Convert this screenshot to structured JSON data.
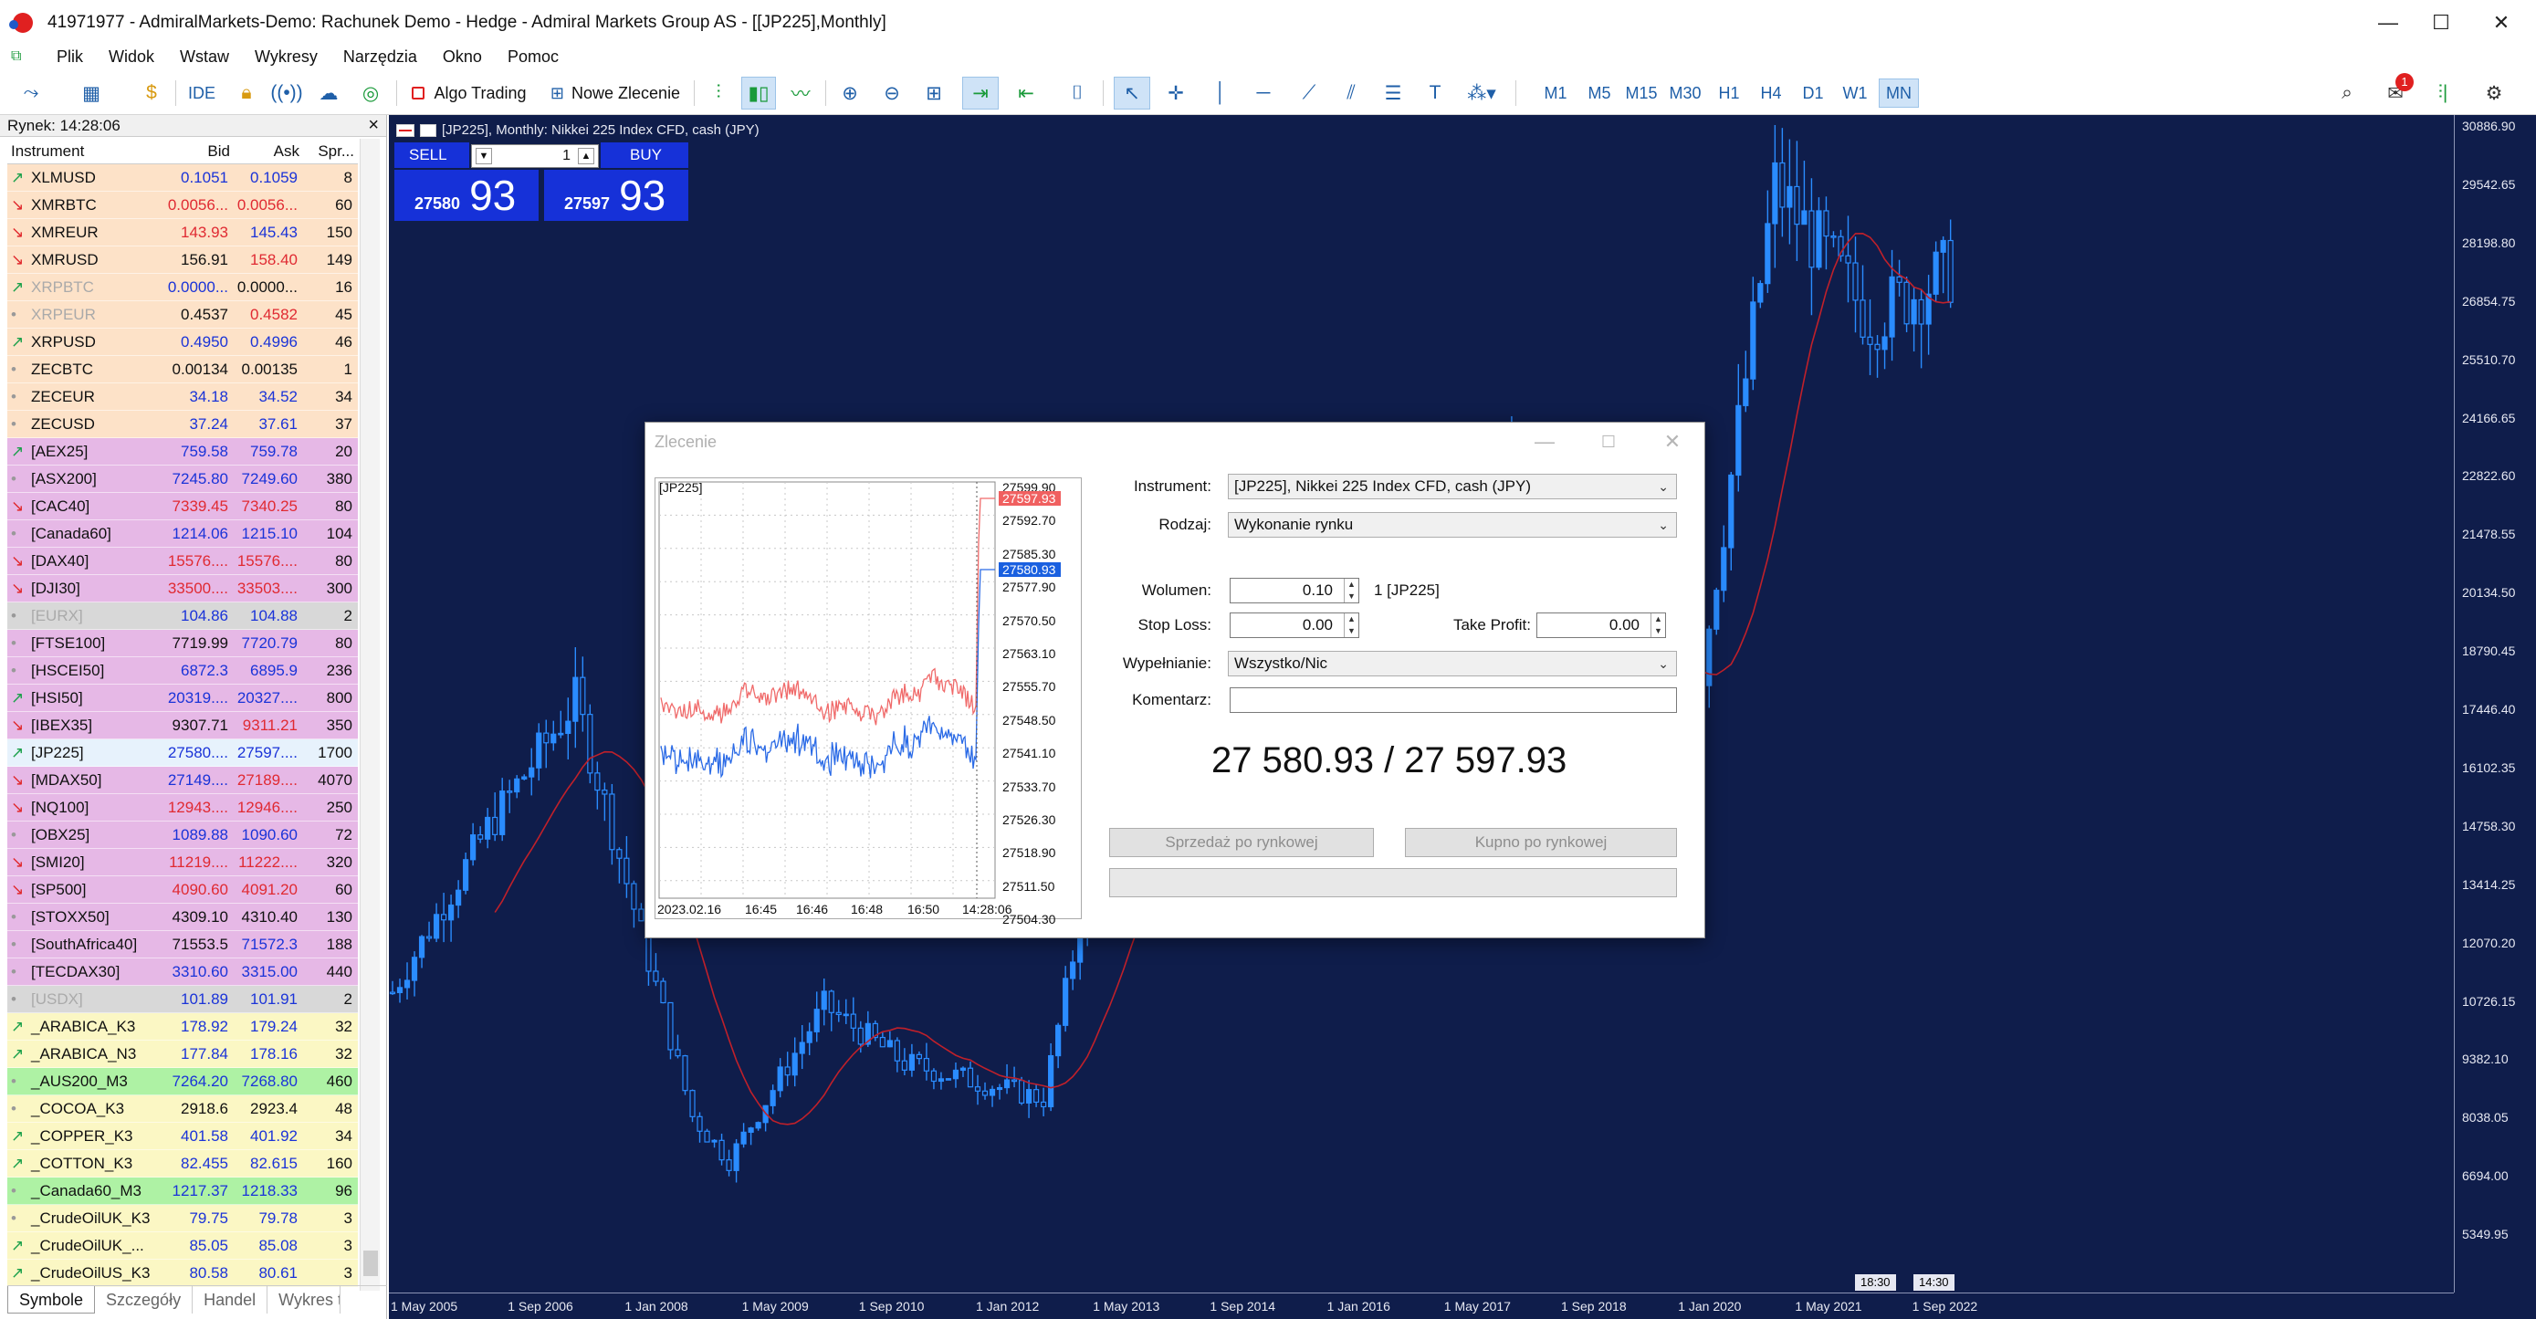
{
  "window": {
    "title": "41971977 - AdmiralMarkets-Demo: Rachunek Demo - Hedge - Admiral Markets Group AS - [[JP225],Monthly]",
    "controls": {
      "minimize": "—",
      "maximize": "☐",
      "close": "✕"
    }
  },
  "menu": [
    "Plik",
    "Widok",
    "Wstaw",
    "Wykresy",
    "Narzędzia",
    "Okno",
    "Pomoc"
  ],
  "toolbar": {
    "ide_label": "IDE",
    "algo_label": "Algo Trading",
    "neworder_label": "Nowe Zlecenie",
    "timeframes": [
      "M1",
      "M5",
      "M15",
      "M30",
      "H1",
      "H4",
      "D1",
      "W1",
      "MN"
    ],
    "active_timeframe": "MN",
    "notification_count": "1"
  },
  "market_watch": {
    "title": "Rynek: 14:28:06",
    "close_label": "×",
    "columns": {
      "instrument": "Instrument",
      "bid": "Bid",
      "ask": "Ask",
      "spread": "Spr..."
    },
    "rows": [
      {
        "arrow": "↗",
        "dir": "up",
        "name": "XLMUSD",
        "bid": "0.1051",
        "ask": "0.1059",
        "spread": "8",
        "group": "g-or",
        "bidc": "blue",
        "askc": "blue"
      },
      {
        "arrow": "↘",
        "dir": "dn",
        "name": "XMRBTC",
        "bid": "0.0056...",
        "ask": "0.0056...",
        "spread": "60",
        "group": "g-or",
        "bidc": "red",
        "askc": "red"
      },
      {
        "arrow": "↘",
        "dir": "dn",
        "name": "XMREUR",
        "bid": "143.93",
        "ask": "145.43",
        "spread": "150",
        "group": "g-or",
        "bidc": "red",
        "askc": "blue"
      },
      {
        "arrow": "↘",
        "dir": "dn",
        "name": "XMRUSD",
        "bid": "156.91",
        "ask": "158.40",
        "spread": "149",
        "group": "g-or",
        "bidc": "",
        "askc": "red"
      },
      {
        "arrow": "↗",
        "dir": "up",
        "name": "XRPBTC",
        "bid": "0.0000...",
        "ask": "0.0000...",
        "spread": "16",
        "group": "g-or",
        "bidc": "blue",
        "askc": "",
        "namec": "gray"
      },
      {
        "arrow": "•",
        "dir": "dot",
        "name": "XRPEUR",
        "bid": "0.4537",
        "ask": "0.4582",
        "spread": "45",
        "group": "g-or",
        "bidc": "",
        "askc": "red",
        "namec": "gray"
      },
      {
        "arrow": "↗",
        "dir": "up",
        "name": "XRPUSD",
        "bid": "0.4950",
        "ask": "0.4996",
        "spread": "46",
        "group": "g-or",
        "bidc": "blue",
        "askc": "blue"
      },
      {
        "arrow": "•",
        "dir": "dot",
        "name": "ZECBTC",
        "bid": "0.00134",
        "ask": "0.00135",
        "spread": "1",
        "group": "g-or",
        "bidc": "",
        "askc": ""
      },
      {
        "arrow": "•",
        "dir": "dot",
        "name": "ZECEUR",
        "bid": "34.18",
        "ask": "34.52",
        "spread": "34",
        "group": "g-or",
        "bidc": "blue",
        "askc": "blue"
      },
      {
        "arrow": "•",
        "dir": "dot",
        "name": "ZECUSD",
        "bid": "37.24",
        "ask": "37.61",
        "spread": "37",
        "group": "g-or",
        "bidc": "blue",
        "askc": "blue"
      },
      {
        "arrow": "↗",
        "dir": "up",
        "name": "[AEX25]",
        "bid": "759.58",
        "ask": "759.78",
        "spread": "20",
        "group": "g-pu",
        "bidc": "blue",
        "askc": "blue"
      },
      {
        "arrow": "•",
        "dir": "dot",
        "name": "[ASX200]",
        "bid": "7245.80",
        "ask": "7249.60",
        "spread": "380",
        "group": "g-pu",
        "bidc": "blue",
        "askc": "blue"
      },
      {
        "arrow": "↘",
        "dir": "dn",
        "name": "[CAC40]",
        "bid": "7339.45",
        "ask": "7340.25",
        "spread": "80",
        "group": "g-pu",
        "bidc": "red",
        "askc": "red"
      },
      {
        "arrow": "•",
        "dir": "dot",
        "name": "[Canada60]",
        "bid": "1214.06",
        "ask": "1215.10",
        "spread": "104",
        "group": "g-pu",
        "bidc": "blue",
        "askc": "blue"
      },
      {
        "arrow": "↘",
        "dir": "dn",
        "name": "[DAX40]",
        "bid": "15576....",
        "ask": "15576....",
        "spread": "80",
        "group": "g-pu",
        "bidc": "red",
        "askc": "red"
      },
      {
        "arrow": "↘",
        "dir": "dn",
        "name": "[DJI30]",
        "bid": "33500....",
        "ask": "33503....",
        "spread": "300",
        "group": "g-pu",
        "bidc": "red",
        "askc": "red"
      },
      {
        "arrow": "•",
        "dir": "dot",
        "name": "[EURX]",
        "bid": "104.86",
        "ask": "104.88",
        "spread": "2",
        "group": "g-gr",
        "bidc": "blue",
        "askc": "blue",
        "namec": "gray"
      },
      {
        "arrow": "•",
        "dir": "dot",
        "name": "[FTSE100]",
        "bid": "7719.99",
        "ask": "7720.79",
        "spread": "80",
        "group": "g-pu",
        "bidc": "",
        "askc": "blue"
      },
      {
        "arrow": "•",
        "dir": "dot",
        "name": "[HSCEI50]",
        "bid": "6872.3",
        "ask": "6895.9",
        "spread": "236",
        "group": "g-pu",
        "bidc": "blue",
        "askc": "blue"
      },
      {
        "arrow": "↗",
        "dir": "up",
        "name": "[HSI50]",
        "bid": "20319....",
        "ask": "20327....",
        "spread": "800",
        "group": "g-pu",
        "bidc": "blue",
        "askc": "blue"
      },
      {
        "arrow": "↘",
        "dir": "dn",
        "name": "[IBEX35]",
        "bid": "9307.71",
        "ask": "9311.21",
        "spread": "350",
        "group": "g-pu",
        "bidc": "",
        "askc": "red"
      },
      {
        "arrow": "↗",
        "dir": "up",
        "name": "[JP225]",
        "bid": "27580....",
        "ask": "27597....",
        "spread": "1700",
        "group": "g-sel",
        "bidc": "blue",
        "askc": "blue"
      },
      {
        "arrow": "↘",
        "dir": "dn",
        "name": "[MDAX50]",
        "bid": "27149....",
        "ask": "27189....",
        "spread": "4070",
        "group": "g-pu",
        "bidc": "blue",
        "askc": "red"
      },
      {
        "arrow": "↘",
        "dir": "dn",
        "name": "[NQ100]",
        "bid": "12943....",
        "ask": "12946....",
        "spread": "250",
        "group": "g-pu",
        "bidc": "red",
        "askc": "red"
      },
      {
        "arrow": "•",
        "dir": "dot",
        "name": "[OBX25]",
        "bid": "1089.88",
        "ask": "1090.60",
        "spread": "72",
        "group": "g-pu",
        "bidc": "blue",
        "askc": "blue"
      },
      {
        "arrow": "↘",
        "dir": "dn",
        "name": "[SMI20]",
        "bid": "11219....",
        "ask": "11222....",
        "spread": "320",
        "group": "g-pu",
        "bidc": "red",
        "askc": "red"
      },
      {
        "arrow": "↘",
        "dir": "dn",
        "name": "[SP500]",
        "bid": "4090.60",
        "ask": "4091.20",
        "spread": "60",
        "group": "g-pu",
        "bidc": "red",
        "askc": "red"
      },
      {
        "arrow": "•",
        "dir": "dot",
        "name": "[STOXX50]",
        "bid": "4309.10",
        "ask": "4310.40",
        "spread": "130",
        "group": "g-pu",
        "bidc": "",
        "askc": ""
      },
      {
        "arrow": "•",
        "dir": "dot",
        "name": "[SouthAfrica40]",
        "bid": "71553.5",
        "ask": "71572.3",
        "spread": "188",
        "group": "g-pu",
        "bidc": "",
        "askc": "blue"
      },
      {
        "arrow": "•",
        "dir": "dot",
        "name": "[TECDAX30]",
        "bid": "3310.60",
        "ask": "3315.00",
        "spread": "440",
        "group": "g-pu",
        "bidc": "blue",
        "askc": "blue"
      },
      {
        "arrow": "•",
        "dir": "dot",
        "name": "[USDX]",
        "bid": "101.89",
        "ask": "101.91",
        "spread": "2",
        "group": "g-gr",
        "bidc": "blue",
        "askc": "blue",
        "namec": "gray"
      },
      {
        "arrow": "↗",
        "dir": "up",
        "name": "_ARABICA_K3",
        "bid": "178.92",
        "ask": "179.24",
        "spread": "32",
        "group": "g-ye",
        "bidc": "blue",
        "askc": "blue"
      },
      {
        "arrow": "↗",
        "dir": "up",
        "name": "_ARABICA_N3",
        "bid": "177.84",
        "ask": "178.16",
        "spread": "32",
        "group": "g-ye",
        "bidc": "blue",
        "askc": "blue"
      },
      {
        "arrow": "•",
        "dir": "dot",
        "name": "_AUS200_M3",
        "bid": "7264.20",
        "ask": "7268.80",
        "spread": "460",
        "group": "g-ge",
        "bidc": "blue",
        "askc": "blue"
      },
      {
        "arrow": "•",
        "dir": "dot",
        "name": "_COCOA_K3",
        "bid": "2918.6",
        "ask": "2923.4",
        "spread": "48",
        "group": "g-ye",
        "bidc": "",
        "askc": ""
      },
      {
        "arrow": "↗",
        "dir": "up",
        "name": "_COPPER_K3",
        "bid": "401.58",
        "ask": "401.92",
        "spread": "34",
        "group": "g-ye",
        "bidc": "blue",
        "askc": "blue"
      },
      {
        "arrow": "↗",
        "dir": "up",
        "name": "_COTTON_K3",
        "bid": "82.455",
        "ask": "82.615",
        "spread": "160",
        "group": "g-ye",
        "bidc": "blue",
        "askc": "blue"
      },
      {
        "arrow": "•",
        "dir": "dot",
        "name": "_Canada60_M3",
        "bid": "1217.37",
        "ask": "1218.33",
        "spread": "96",
        "group": "g-ge",
        "bidc": "blue",
        "askc": "blue"
      },
      {
        "arrow": "•",
        "dir": "dot",
        "name": "_CrudeOilUK_K3",
        "bid": "79.75",
        "ask": "79.78",
        "spread": "3",
        "group": "g-ye",
        "bidc": "blue",
        "askc": "blue"
      },
      {
        "arrow": "↗",
        "dir": "up",
        "name": "_CrudeOilUK_...",
        "bid": "85.05",
        "ask": "85.08",
        "spread": "3",
        "group": "g-ye",
        "bidc": "blue",
        "askc": "blue"
      },
      {
        "arrow": "↗",
        "dir": "up",
        "name": "_CrudeOilUS_K3",
        "bid": "80.58",
        "ask": "80.61",
        "spread": "3",
        "group": "g-ye",
        "bidc": "blue",
        "askc": "blue"
      }
    ],
    "tabs": [
      "Symbole",
      "Szczegóły",
      "Handel",
      "Wykres ticków"
    ],
    "active_tab": "Symbole"
  },
  "chart": {
    "header": "[JP225], Monthly:  Nikkei 225 Index CFD, cash (JPY)",
    "one_click": {
      "sell_label": "SELL",
      "buy_label": "BUY",
      "volume": "1",
      "sell_small": "27580",
      "sell_big": "93",
      "buy_small": "27597",
      "buy_big": "93"
    },
    "colors": {
      "background": "#0f1d4b",
      "bull": "#2a8cff",
      "ma": "#c0202a"
    },
    "y_ticks": [
      "30886.90",
      "29542.65",
      "28198.80",
      "26854.75",
      "25510.70",
      "24166.65",
      "22822.60",
      "21478.55",
      "20134.50",
      "18790.45",
      "17446.40",
      "16102.35",
      "14758.30",
      "13414.25",
      "12070.20",
      "10726.15",
      "9382.10",
      "8038.05",
      "6694.00",
      "5349.95"
    ],
    "x_ticks": [
      "1 May 2005",
      "1 Sep 2006",
      "1 Jan 2008",
      "1 May 2009",
      "1 Sep 2010",
      "1 Jan 2012",
      "1 May 2013",
      "1 Sep 2014",
      "1 Jan 2016",
      "1 May 2017",
      "1 Sep 2018",
      "1 Jan 2020",
      "1 May 2021",
      "1 Sep 2022"
    ],
    "time_boxes": [
      "18:30",
      "14:30"
    ]
  },
  "chart_data": {
    "type": "candlestick",
    "series": [
      {
        "name": "[JP225]",
        "timeframe": "Monthly"
      }
    ],
    "ylim": [
      5349.95,
      30886.9
    ],
    "x_range": [
      "2005-04",
      "2023-02"
    ],
    "close_approx": [
      {
        "x": "2005-05",
        "y": 11300
      },
      {
        "x": "2006-06",
        "y": 15000
      },
      {
        "x": "2007-06",
        "y": 17900
      },
      {
        "x": "2008-10",
        "y": 8500
      },
      {
        "x": "2009-03",
        "y": 7500
      },
      {
        "x": "2010-04",
        "y": 11000
      },
      {
        "x": "2011-03",
        "y": 9700
      },
      {
        "x": "2012-10",
        "y": 8900
      },
      {
        "x": "2013-05",
        "y": 14500
      },
      {
        "x": "2015-06",
        "y": 20500
      },
      {
        "x": "2016-06",
        "y": 15800
      },
      {
        "x": "2018-01",
        "y": 23500
      },
      {
        "x": "2018-12",
        "y": 19800
      },
      {
        "x": "2020-03",
        "y": 17500
      },
      {
        "x": "2021-02",
        "y": 29500
      },
      {
        "x": "2022-03",
        "y": 26500
      },
      {
        "x": "2023-02",
        "y": 27580
      }
    ]
  },
  "order_dialog": {
    "title": "Zlecenie",
    "mini_chart": {
      "symbol": "[JP225]",
      "price_ticks": [
        "27599.90",
        "27592.70",
        "27585.30",
        "27577.90",
        "27570.50",
        "27563.10",
        "27555.70",
        "27548.50",
        "27541.10",
        "27533.70",
        "27526.30",
        "27518.90",
        "27511.50",
        "27504.30"
      ],
      "ask_tag": "27597.93",
      "bid_tag": "27580.93",
      "time_ticks": [
        "2023.02.16",
        "16:45",
        "16:46",
        "16:48",
        "16:50",
        "14:28:06"
      ]
    },
    "instrument_label": "Instrument:",
    "instrument_value": "[JP225], Nikkei 225 Index CFD, cash (JPY)",
    "type_label": "Rodzaj:",
    "type_value": "Wykonanie rynku",
    "volume_label": "Wolumen:",
    "volume_value": "0.10",
    "volume_unit": "1 [JP225]",
    "sl_label": "Stop Loss:",
    "sl_value": "0.00",
    "tp_label": "Take Profit:",
    "tp_value": "0.00",
    "fill_label": "Wypełnianie:",
    "fill_value": "Wszystko/Nic",
    "comment_label": "Komentarz:",
    "comment_value": "",
    "price_display": "27 580.93 / 27 597.93",
    "sell_button": "Sprzedaż po rynkowej",
    "buy_button": "Kupno po rynkowej"
  }
}
